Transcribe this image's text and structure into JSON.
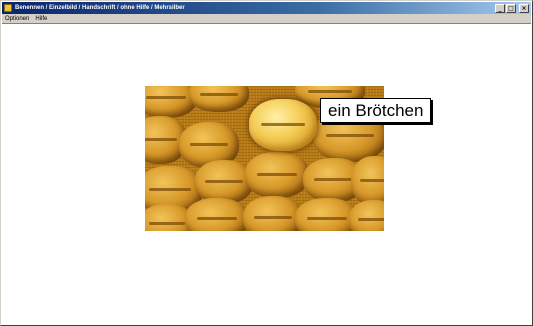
{
  "window": {
    "title": "Benennen / Einzelbild / Handschrift / ohne Hilfe / Mehrsilber",
    "buttons": {
      "minimize": "_",
      "maximize": "□",
      "close": "×"
    }
  },
  "menu": [
    {
      "label": "Optionen"
    },
    {
      "label": "Hilfe"
    }
  ],
  "main": {
    "image_label": "ein Brötchen",
    "image_subject": "bread rolls"
  },
  "colors": {
    "titlebar_start": "#0a246a",
    "titlebar_end": "#a6caf0",
    "client_bg": "#ffffff",
    "bread": "#d89a2a"
  }
}
